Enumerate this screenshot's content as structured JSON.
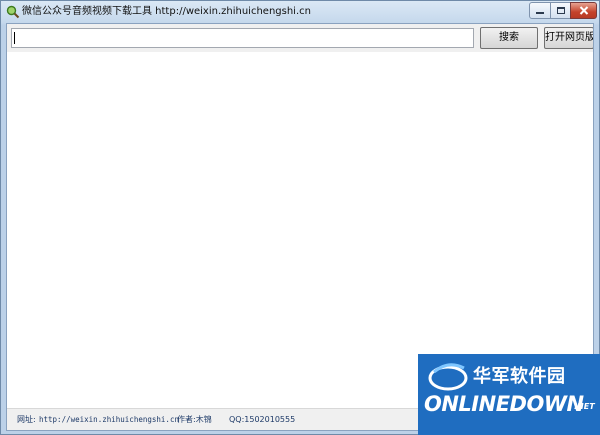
{
  "window": {
    "title": "微信公众号音频视频下载工具 http://weixin.zhihuichengshi.cn"
  },
  "toolbar": {
    "search_value": "",
    "search_button": "搜索",
    "open_page_button": "打开网页版"
  },
  "statusbar": {
    "url_label": "网址:",
    "url": "http://weixin.zhihuichengshi.cn",
    "author": "作者:木锦",
    "qq": "QQ:1502010555"
  },
  "watermark": {
    "chinese": "华军软件园",
    "brand": "ONLINEDOWN",
    "tld": ".NET"
  },
  "colors": {
    "titlebar": "#c5d8ec",
    "close_button": "#c4432b",
    "statusbar_text": "#1e3a68",
    "watermark_bg": "#1f6dc0"
  }
}
